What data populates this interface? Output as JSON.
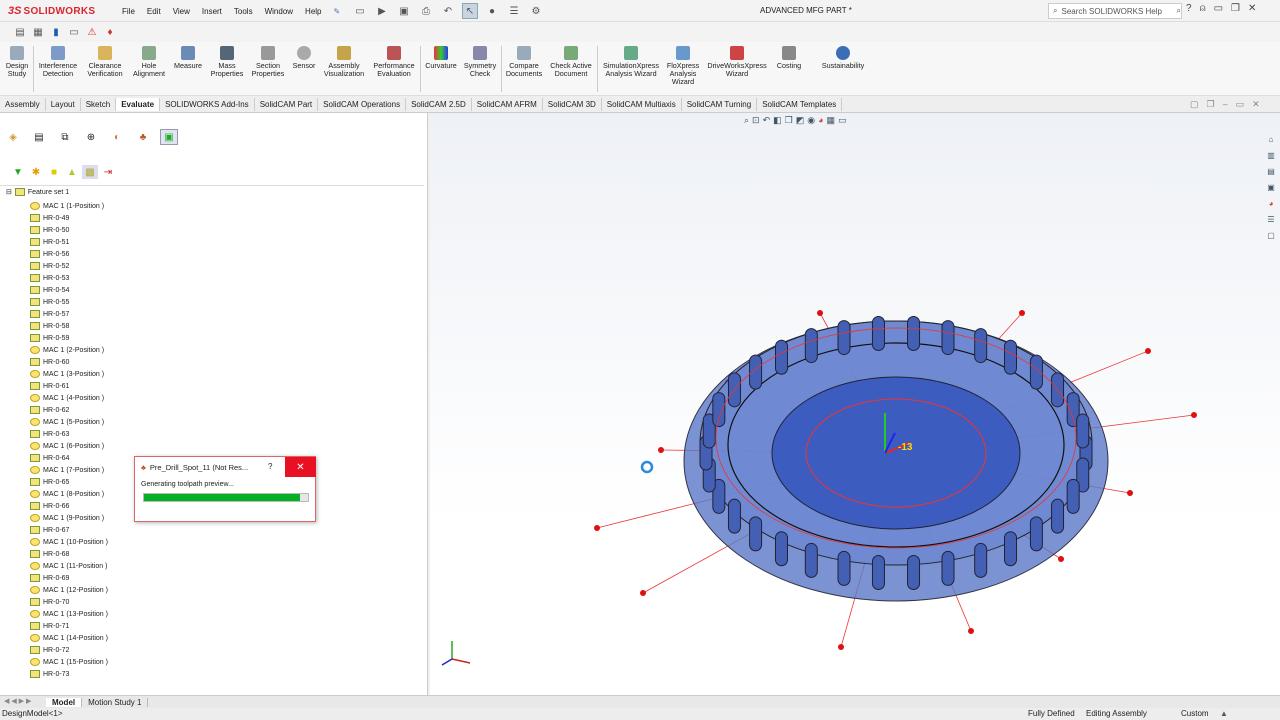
{
  "app": {
    "logo_prefix": "3S",
    "logo_text": "SOLIDWORKS",
    "title": "ADVANCED MFG PART *"
  },
  "menu": [
    "File",
    "Edit",
    "View",
    "Insert",
    "Tools",
    "Window",
    "Help"
  ],
  "search": {
    "placeholder": "Search SOLIDWORKS Help"
  },
  "ribbon": {
    "design_study": "Design Study",
    "interference": "Interference Detection",
    "clearance": "Clearance Verification",
    "hole": "Hole Alignment",
    "measure": "Measure",
    "mass": "Mass Properties",
    "section": "Section Properties",
    "sensor": "Sensor",
    "assembly_vis": "Assembly Visualization",
    "performance": "Performance Evaluation",
    "curvature": "Curvature",
    "symmetry": "Symmetry Check",
    "compare": "Compare Documents",
    "check_active": "Check Active Document",
    "simxpress": "SimulationXpress Analysis Wizard",
    "floxpress": "FloXpress Analysis Wizard",
    "driveworks": "DriveWorksXpress Wizard",
    "costing": "Costing",
    "sustainability": "Sustainability"
  },
  "tabs": [
    "Assembly",
    "Layout",
    "Sketch",
    "Evaluate",
    "SOLIDWORKS Add-Ins",
    "SolidCAM Part",
    "SolidCAM Operations",
    "SolidCAM 2.5D",
    "SolidCAM AFRM",
    "SolidCAM 3D",
    "SolidCAM Multiaxis",
    "SolidCAM Turning",
    "SolidCAM Templates"
  ],
  "tree": {
    "root": "Feature set 1",
    "items": [
      {
        "kind": "mac",
        "label": "MAC 1 (1-Position )"
      },
      {
        "kind": "hr",
        "label": "HR-0-49"
      },
      {
        "kind": "hr",
        "label": "HR-0-50"
      },
      {
        "kind": "hr",
        "label": "HR-0-51"
      },
      {
        "kind": "hr",
        "label": "HR-0-56"
      },
      {
        "kind": "hr",
        "label": "HR-0-52"
      },
      {
        "kind": "hr",
        "label": "HR-0-53"
      },
      {
        "kind": "hr",
        "label": "HR-0-54"
      },
      {
        "kind": "hr",
        "label": "HR-0-55"
      },
      {
        "kind": "hr",
        "label": "HR-0-57"
      },
      {
        "kind": "hr",
        "label": "HR-0-58"
      },
      {
        "kind": "hr",
        "label": "HR-0-59"
      },
      {
        "kind": "mac",
        "label": "MAC 1 (2-Position )"
      },
      {
        "kind": "hr",
        "label": "HR-0-60"
      },
      {
        "kind": "mac",
        "label": "MAC 1 (3-Position )"
      },
      {
        "kind": "hr",
        "label": "HR-0-61"
      },
      {
        "kind": "mac",
        "label": "MAC 1 (4-Position )"
      },
      {
        "kind": "hr",
        "label": "HR-0-62"
      },
      {
        "kind": "mac",
        "label": "MAC 1 (5-Position )"
      },
      {
        "kind": "hr",
        "label": "HR-0-63"
      },
      {
        "kind": "mac",
        "label": "MAC 1 (6-Position )"
      },
      {
        "kind": "hr",
        "label": "HR-0-64"
      },
      {
        "kind": "mac",
        "label": "MAC 1 (7-Position )"
      },
      {
        "kind": "hr",
        "label": "HR-0-65"
      },
      {
        "kind": "mac",
        "label": "MAC 1 (8-Position )"
      },
      {
        "kind": "hr",
        "label": "HR-0-66"
      },
      {
        "kind": "mac",
        "label": "MAC 1 (9-Position )"
      },
      {
        "kind": "hr",
        "label": "HR-0-67"
      },
      {
        "kind": "mac",
        "label": "MAC 1 (10-Position )"
      },
      {
        "kind": "hr",
        "label": "HR-0-68"
      },
      {
        "kind": "mac",
        "label": "MAC 1 (11-Position )"
      },
      {
        "kind": "hr",
        "label": "HR-0-69"
      },
      {
        "kind": "mac",
        "label": "MAC 1 (12-Position )"
      },
      {
        "kind": "hr",
        "label": "HR-0-70"
      },
      {
        "kind": "mac",
        "label": "MAC 1 (13-Position )"
      },
      {
        "kind": "hr",
        "label": "HR-0-71"
      },
      {
        "kind": "mac",
        "label": "MAC 1 (14-Position )"
      },
      {
        "kind": "hr",
        "label": "HR-0-72"
      },
      {
        "kind": "mac",
        "label": "MAC 1 (15-Position )"
      },
      {
        "kind": "hr",
        "label": "HR-0-73"
      }
    ]
  },
  "dialog": {
    "title": "Pre_Drill_Spot_11 (Not Res...",
    "help": "?",
    "close": "✕",
    "message": "Generating toolpath preview...",
    "progress": 0.95
  },
  "viewport": {
    "dimension_label": "-13"
  },
  "bottom_tabs": [
    "Model",
    "Motion Study 1"
  ],
  "status": {
    "left": "DesignModel<1>",
    "defined": "Fully Defined",
    "mode": "Editing Assembly",
    "units": "Custom",
    "arrow": "▲"
  },
  "colors": {
    "accent": "#d9262e",
    "progress": "#06b025",
    "part": "#5a78c8"
  }
}
